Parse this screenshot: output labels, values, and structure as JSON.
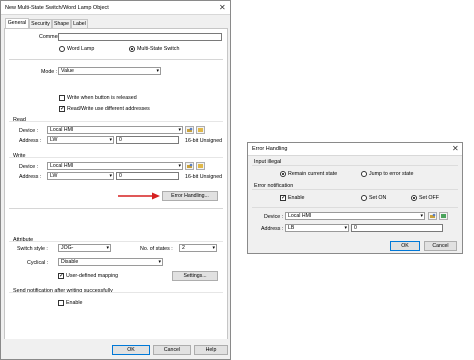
{
  "main_dialog": {
    "title": "New Multi-State Switch/Word Lamp Object",
    "tabs": [
      "General",
      "Security",
      "Shape",
      "Label"
    ],
    "comment_label": "Comment :",
    "comment_value": "",
    "type_options": [
      "Word Lamp",
      "Multi-State Switch"
    ],
    "mode_label": "Mode :",
    "mode_value": "Value",
    "write_when_released": "Write when button is released",
    "read_write_diff": "Read/Write use different addresses",
    "read_section": "Read",
    "device_label": "Device :",
    "address_label": "Address :",
    "read_device": "Local HMI",
    "read_addr_type": "LW",
    "read_addr_value": "0",
    "read_format": "16-bit Unsigned",
    "write_section": "Write",
    "write_device": "Local HMI",
    "write_addr_type": "LW",
    "write_addr_value": "0",
    "write_format": "16-bit Unsigned",
    "error_handling_button": "Error Handling...",
    "attribute_section": "Attribute",
    "switch_style_label": "Switch style :",
    "switch_style_value": "JOG-",
    "num_states_label": "No. of states :",
    "num_states_value": "2",
    "cyclical_label": "Cyclical :",
    "cyclical_value": "Disable",
    "user_defined_mapping": "User-defined mapping",
    "settings_button": "Settings...",
    "send_notification_section": "Send notification after writing successfully",
    "enable_label": "Enable",
    "ok_button": "OK",
    "cancel_button": "Cancel",
    "help_button": "Help"
  },
  "error_dialog": {
    "title": "Error Handling",
    "input_illegal_section": "Input illegal",
    "remain_current": "Remain current state",
    "jump_error": "Jump to error state",
    "error_notification_section": "Error notification",
    "enable_label": "Enable",
    "set_on": "Set ON",
    "set_off": "Set OFF",
    "device_label": "Device :",
    "device_value": "Local HMI",
    "address_label": "Address :",
    "addr_type": "LB",
    "addr_value": "0",
    "ok_button": "OK",
    "cancel_button": "Cancel"
  },
  "colors": {
    "arrow": "#d62020",
    "accent": "#0078d7"
  },
  "icons": [
    "close-icon",
    "chevron-down-icon",
    "settings-icon",
    "tag-icon",
    "arrow-right-icon"
  ]
}
